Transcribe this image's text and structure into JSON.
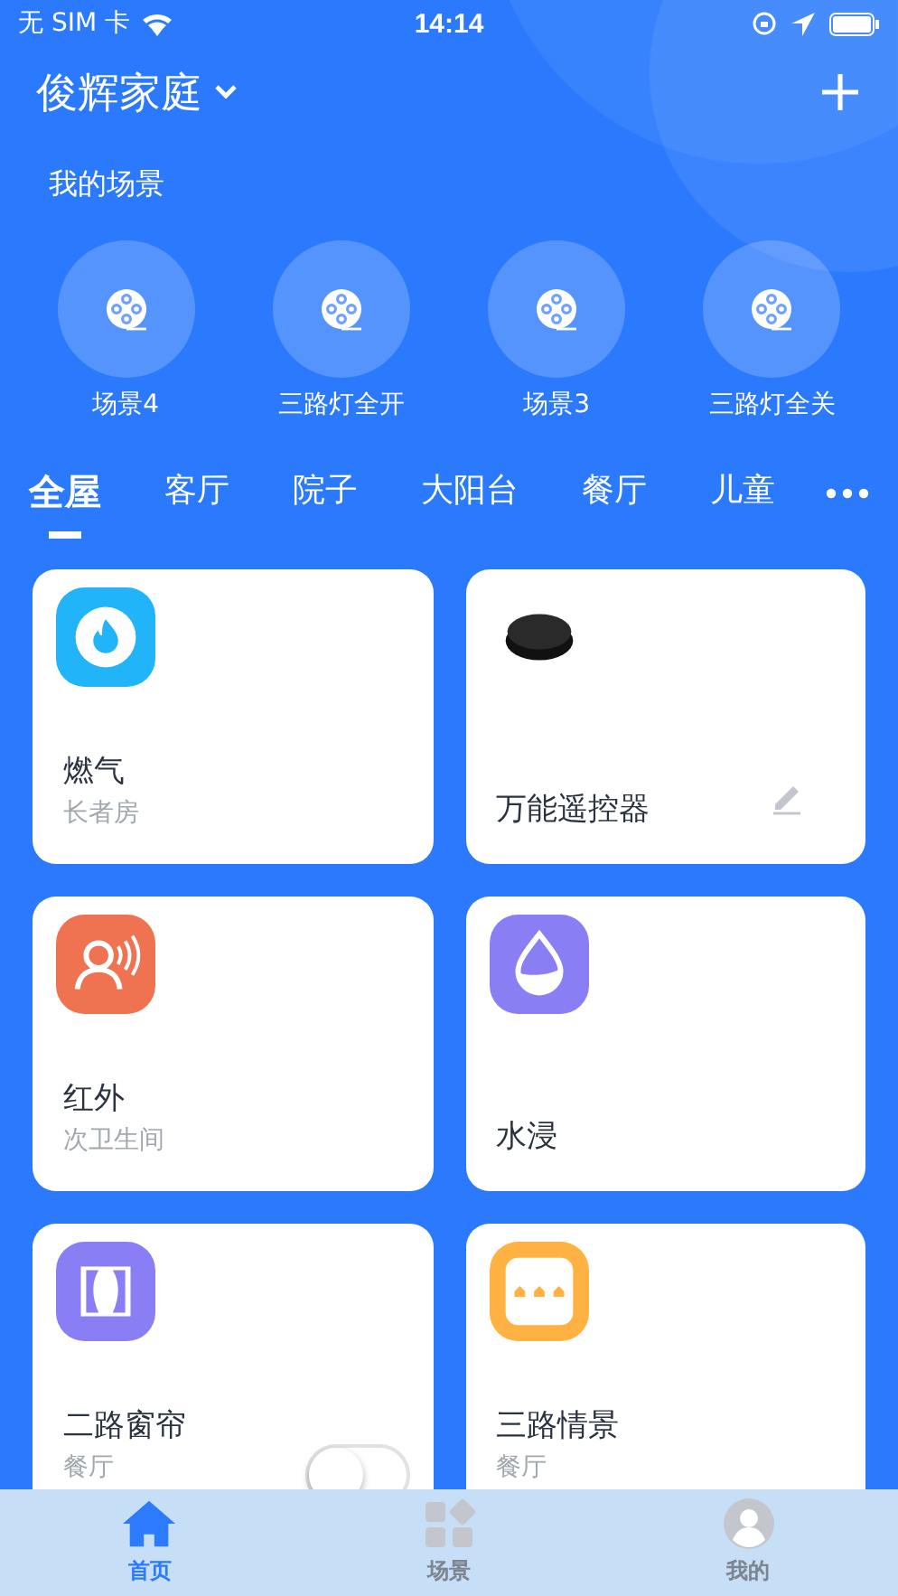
{
  "status_bar": {
    "carrier": "无 SIM 卡",
    "time": "14:14"
  },
  "header": {
    "home_name": "俊辉家庭"
  },
  "scenes_title": "我的场景",
  "scenes": [
    {
      "label": "场景4"
    },
    {
      "label": "三路灯全开"
    },
    {
      "label": "场景3"
    },
    {
      "label": "三路灯全关"
    }
  ],
  "room_tabs": [
    {
      "label": "全屋",
      "selected": true
    },
    {
      "label": "客厅",
      "selected": false
    },
    {
      "label": "院子",
      "selected": false
    },
    {
      "label": "大阳台",
      "selected": false
    },
    {
      "label": "餐厅",
      "selected": false
    },
    {
      "label": "儿童",
      "selected": false
    }
  ],
  "devices": [
    {
      "kind": "gas",
      "name": "燃气",
      "room": "长者房"
    },
    {
      "kind": "remote",
      "name": "万能遥控器",
      "editable": true
    },
    {
      "kind": "infrared",
      "name": "红外",
      "room": "次卫生间"
    },
    {
      "kind": "water",
      "name": "水浸"
    },
    {
      "kind": "curtain",
      "name": "二路窗帘",
      "room": "餐厅",
      "switch": {
        "on": false
      }
    },
    {
      "kind": "scene",
      "name": "三路情景",
      "room": "餐厅"
    }
  ],
  "bottom_tabs": [
    {
      "kind": "home",
      "label": "首页",
      "selected": true
    },
    {
      "kind": "scene",
      "label": "场景",
      "selected": false
    },
    {
      "kind": "profile",
      "label": "我的",
      "selected": false
    }
  ]
}
